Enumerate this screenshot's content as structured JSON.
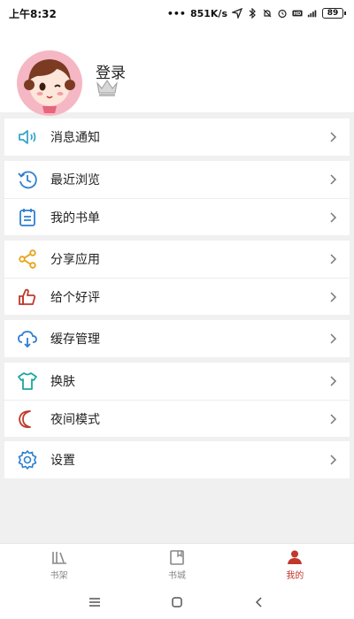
{
  "status_bar": {
    "time": "上午8:32",
    "network_speed": "851K/s",
    "battery": "89",
    "icons": [
      "location-icon",
      "bluetooth-icon",
      "mute-icon",
      "alarm-icon",
      "hd-icon",
      "signal-4g-icon",
      "battery-icon"
    ]
  },
  "profile": {
    "login_label": "登录",
    "avatar_icon": "avatar-girl-icon",
    "crown_icon": "crown-icon"
  },
  "sections": [
    {
      "items": [
        {
          "label": "消息通知",
          "icon": "speaker-icon",
          "color": "#3aa6c9"
        }
      ]
    },
    {
      "items": [
        {
          "label": "最近浏览",
          "icon": "history-icon",
          "color": "#2f7fd0"
        },
        {
          "label": "我的书单",
          "icon": "booklist-icon",
          "color": "#2f7fd0"
        }
      ]
    },
    {
      "items": [
        {
          "label": "分享应用",
          "icon": "share-icon",
          "color": "#e8a317"
        },
        {
          "label": "给个好评",
          "icon": "thumbs-up-icon",
          "color": "#c0392b"
        }
      ]
    },
    {
      "items": [
        {
          "label": "缓存管理",
          "icon": "cloud-download-icon",
          "color": "#2f7fd0"
        }
      ]
    },
    {
      "items": [
        {
          "label": "换肤",
          "icon": "tshirt-icon",
          "color": "#1fa5a0"
        },
        {
          "label": "夜间模式",
          "icon": "moon-icon",
          "color": "#c0392b"
        }
      ]
    },
    {
      "items": [
        {
          "label": "设置",
          "icon": "gear-icon",
          "color": "#2f7fd0"
        }
      ]
    }
  ],
  "bottom_nav": [
    {
      "label": "书架",
      "icon": "bookshelf-icon",
      "active": false
    },
    {
      "label": "书城",
      "icon": "bookstore-icon",
      "active": false
    },
    {
      "label": "我的",
      "icon": "user-icon",
      "active": true
    }
  ],
  "system_nav": [
    "menu-icon",
    "home-icon",
    "back-icon"
  ],
  "colors": {
    "accent": "#c0392b",
    "background": "#f0f0f0"
  }
}
